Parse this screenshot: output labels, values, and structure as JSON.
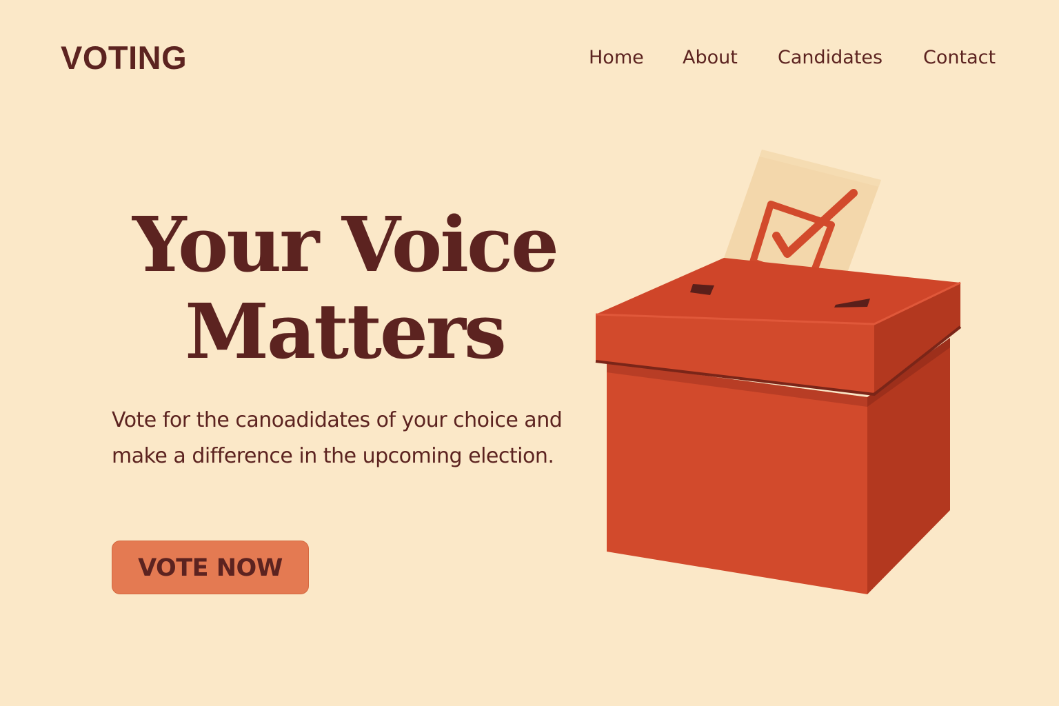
{
  "header": {
    "logo": "VOTING",
    "nav": [
      {
        "label": "Home"
      },
      {
        "label": "About"
      },
      {
        "label": "Candidates"
      },
      {
        "label": "Contact"
      }
    ]
  },
  "hero": {
    "title_line1": "Your Voice",
    "title_line2": "Matters",
    "subtitle": "Vote for the canoadidates of your choice and make a difference in the upcoming election.",
    "cta_label": "VOTE NOW"
  },
  "illustration": {
    "icon": "ballot-box-icon",
    "ballot_icon": "checkbox-checked-icon"
  },
  "colors": {
    "background": "#fbe8c8",
    "text": "#5c2320",
    "accent": "#e47a52",
    "box": "#d24a2c",
    "ballot": "#f3d7ab"
  }
}
